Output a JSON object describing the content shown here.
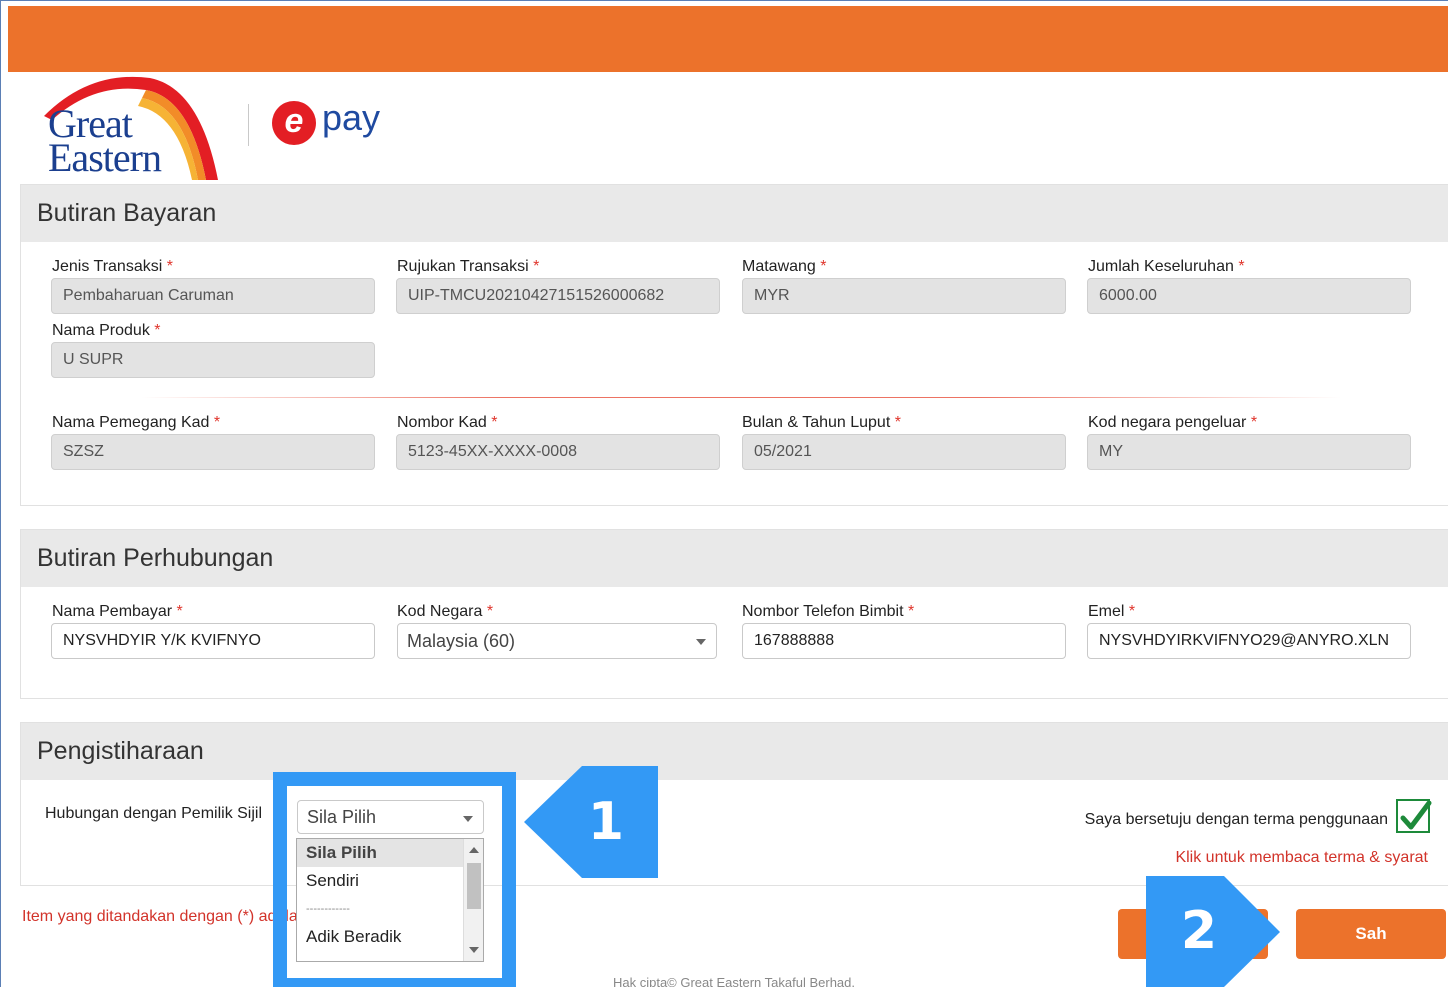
{
  "brand": {
    "logo_line1": "Great",
    "logo_line2": "Eastern",
    "epay_mark": "e",
    "epay_text": "pay"
  },
  "payment": {
    "title": "Butiran Bayaran",
    "fields": [
      {
        "label": "Jenis Transaksi",
        "value": "Pembaharuan Caruman"
      },
      {
        "label": "Rujukan Transaksi",
        "value": "UIP-TMCU20210427151526000682"
      },
      {
        "label": "Matawang",
        "value": "MYR"
      },
      {
        "label": "Jumlah Keseluruhan",
        "value": "6000.00"
      },
      {
        "label": "Nama Produk",
        "value": "U SUPR"
      },
      {
        "label": "Nama Pemegang Kad",
        "value": "SZSZ"
      },
      {
        "label": "Nombor Kad",
        "value": "5123-45XX-XXXX-0008"
      },
      {
        "label": "Bulan & Tahun Luput",
        "value": "05/2021"
      },
      {
        "label": "Kod negara pengeluar",
        "value": "MY"
      }
    ]
  },
  "contact": {
    "title": "Butiran Perhubungan",
    "payer_name_label": "Nama Pembayar",
    "payer_name_value": "NYSVHDYIR Y/K KVIFNYO",
    "country_code_label": "Kod Negara",
    "country_code_value": "Malaysia (60)",
    "phone_label": "Nombor Telefon Bimbit",
    "phone_value": "167888888",
    "email_label": "Emel",
    "email_value": "NYSVHDYIRKVIFNYO29@ANYRO.XLN"
  },
  "declaration": {
    "title": "Pengistiharaan",
    "relationship_label": "Hubungan dengan Pemilik Sijil",
    "relationship_selected": "Sila Pilih",
    "relationship_options": [
      "Sila Pilih",
      "Sendiri",
      "------------",
      "Adik Beradik"
    ],
    "agree_text": "Saya bersetuju dengan terma penggunaan",
    "terms_link": "Klik untuk membaca terma & syarat"
  },
  "required_marker": "*",
  "note": "Item yang ditandakan dengan (*) adalah",
  "submit_label": "Sah",
  "footer": "Hak cipta© Great Eastern Takaful Berhad.",
  "annotations": {
    "step1": "1",
    "step2": "2"
  },
  "colors": {
    "brand_orange": "#ec722b",
    "annotation_blue": "#3399f5",
    "required_red": "#e0352c"
  }
}
